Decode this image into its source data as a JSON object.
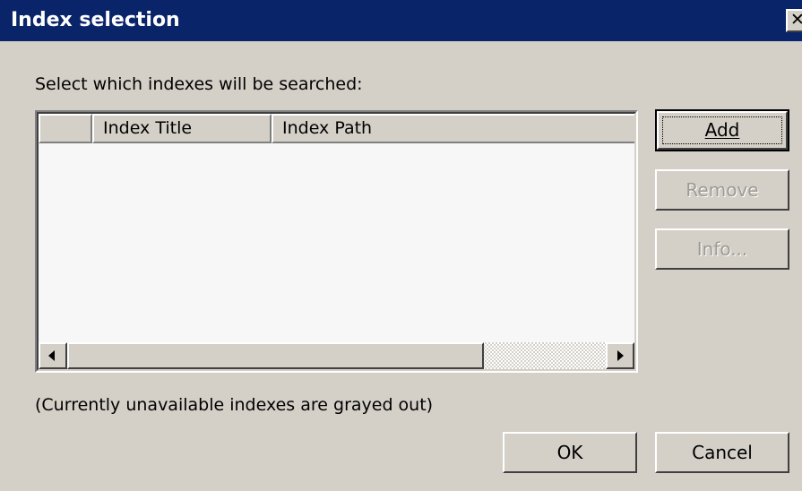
{
  "window": {
    "title": "Index selection",
    "close_glyph": "✕"
  },
  "instructions": "Select which indexes will be searched:",
  "list": {
    "columns": [
      "",
      "Index Title",
      "Index Path"
    ],
    "rows": []
  },
  "buttons": {
    "add": "Add",
    "remove": "Remove",
    "info": "Info...",
    "ok": "OK",
    "cancel": "Cancel"
  },
  "footnote": "(Currently unavailable indexes are grayed out)",
  "icons": {
    "scroll_left": "arrow-left-icon",
    "scroll_right": "arrow-right-icon"
  }
}
